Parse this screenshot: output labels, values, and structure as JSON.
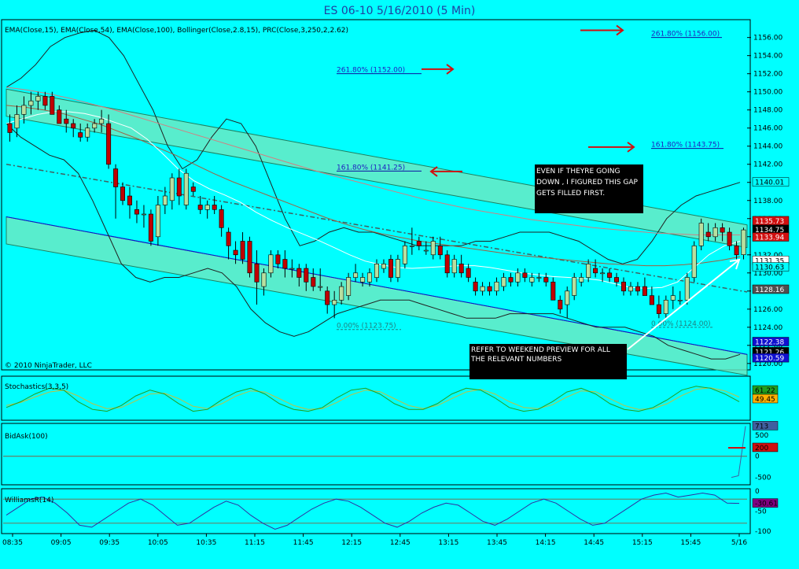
{
  "title": "ES 06-10  5/16/2010 (5 Min)",
  "colors": {
    "background": "#00FFFF",
    "up_candle": "#B8E0A0",
    "down_candle": "#C00000",
    "band": "#6EE8C0",
    "arrow": "#D01010",
    "axis_text": "#000000"
  },
  "chart_data": [
    {
      "type": "candlestick",
      "name": "price_panel",
      "indicator_label": "EMA(Close,15), EMA(Close,54), EMA(Close,100), Bollinger(Close,2.8,15), PRC(Close,3,250,2,2.62)",
      "copyright": "© 2010 NinjaTrader, LLC",
      "yticks": [
        1120,
        1122,
        1124,
        1126,
        1128,
        1130,
        1132,
        1134,
        1136,
        1138,
        1140,
        1142,
        1144,
        1146,
        1148,
        1150,
        1152,
        1154,
        1156
      ],
      "ylim": [
        1119.9,
        1157.1
      ],
      "xlabels": [
        "08:35",
        "09:05",
        "09:35",
        "10:05",
        "10:35",
        "11:15",
        "11:45",
        "12:15",
        "12:45",
        "13:15",
        "13:45",
        "14:15",
        "14:45",
        "15:15",
        "15:45",
        "5/16"
      ],
      "candles": [
        [
          1146.5,
          1147.5,
          1144.5,
          1145.5
        ],
        [
          1146.0,
          1148.5,
          1145.0,
          1147.5
        ],
        [
          1147.5,
          1149.5,
          1146.5,
          1148.5
        ],
        [
          1148.5,
          1150.0,
          1147.5,
          1149.0
        ],
        [
          1149.0,
          1150.0,
          1148.0,
          1149.5
        ],
        [
          1149.5,
          1150.0,
          1148.0,
          1148.5
        ],
        [
          1149.5,
          1150.0,
          1147.5,
          1147.5
        ],
        [
          1148.0,
          1148.5,
          1146.5,
          1146.5
        ],
        [
          1147.0,
          1148.0,
          1145.5,
          1146.5
        ],
        [
          1146.5,
          1147.0,
          1145.0,
          1146.0
        ],
        [
          1145.5,
          1146.5,
          1144.5,
          1145.0
        ],
        [
          1145.0,
          1146.5,
          1144.5,
          1146.0
        ],
        [
          1146.0,
          1147.0,
          1145.5,
          1146.5
        ],
        [
          1146.5,
          1148.0,
          1145.5,
          1147.0
        ],
        [
          1146.5,
          1147.5,
          1141.5,
          1142.0
        ],
        [
          1141.5,
          1142.0,
          1136.0,
          1139.5
        ],
        [
          1139.5,
          1140.0,
          1137.5,
          1138.0
        ],
        [
          1138.5,
          1139.5,
          1136.0,
          1137.5
        ],
        [
          1137.0,
          1138.0,
          1135.5,
          1136.5
        ],
        [
          1136.5,
          1137.5,
          1135.0,
          1136.5
        ],
        [
          1136.5,
          1137.0,
          1133.0,
          1133.5
        ],
        [
          1134.0,
          1138.5,
          1133.0,
          1137.5
        ],
        [
          1137.5,
          1139.5,
          1136.5,
          1138.5
        ],
        [
          1138.0,
          1141.0,
          1137.0,
          1140.5
        ],
        [
          1140.5,
          1141.5,
          1137.5,
          1138.5
        ],
        [
          1137.5,
          1141.5,
          1137.0,
          1141.0
        ],
        [
          1139.5,
          1140.0,
          1138.5,
          1139.0
        ],
        [
          1137.5,
          1138.5,
          1136.5,
          1137.0
        ],
        [
          1137.0,
          1138.0,
          1136.0,
          1137.5
        ],
        [
          1137.5,
          1138.5,
          1136.5,
          1137.0
        ],
        [
          1137.0,
          1137.5,
          1134.0,
          1135.0
        ],
        [
          1134.5,
          1135.0,
          1131.5,
          1133.0
        ],
        [
          1132.5,
          1133.5,
          1131.0,
          1132.0
        ],
        [
          1133.5,
          1134.5,
          1131.0,
          1131.5
        ],
        [
          1133.5,
          1134.0,
          1129.5,
          1130.0
        ],
        [
          1131.0,
          1132.5,
          1126.5,
          1129.0
        ],
        [
          1128.5,
          1130.5,
          1127.5,
          1130.0
        ],
        [
          1130.0,
          1132.5,
          1129.5,
          1132.0
        ],
        [
          1132.0,
          1132.5,
          1130.5,
          1131.0
        ],
        [
          1131.5,
          1132.5,
          1129.5,
          1130.5
        ],
        [
          1130.5,
          1131.5,
          1129.5,
          1130.5
        ],
        [
          1130.5,
          1131.0,
          1128.5,
          1129.5
        ],
        [
          1130.5,
          1131.0,
          1128.0,
          1129.0
        ],
        [
          1129.5,
          1130.5,
          1128.0,
          1128.5
        ],
        [
          1128.5,
          1130.5,
          1128.0,
          1128.5
        ],
        [
          1128.0,
          1128.5,
          1125.5,
          1126.5
        ],
        [
          1126.5,
          1128.0,
          1125.0,
          1127.0
        ],
        [
          1127.0,
          1129.0,
          1126.5,
          1128.5
        ],
        [
          1127.5,
          1130.0,
          1127.0,
          1129.5
        ],
        [
          1129.5,
          1131.0,
          1129.0,
          1130.0
        ],
        [
          1129.0,
          1130.0,
          1128.5,
          1129.5
        ],
        [
          1129.0,
          1130.5,
          1128.5,
          1130.0
        ],
        [
          1129.5,
          1131.5,
          1129.0,
          1131.0
        ],
        [
          1130.5,
          1131.5,
          1130.0,
          1131.0
        ],
        [
          1131.5,
          1132.0,
          1129.0,
          1129.5
        ],
        [
          1129.5,
          1132.0,
          1129.0,
          1131.5
        ],
        [
          1131.0,
          1133.5,
          1130.5,
          1133.0
        ],
        [
          1133.0,
          1135.0,
          1132.0,
          1133.0
        ],
        [
          1133.5,
          1134.0,
          1132.5,
          1133.0
        ],
        [
          1132.5,
          1133.5,
          1132.0,
          1132.5
        ],
        [
          1132.0,
          1134.0,
          1131.5,
          1133.5
        ],
        [
          1133.0,
          1134.0,
          1131.5,
          1132.0
        ],
        [
          1132.0,
          1132.5,
          1129.5,
          1130.0
        ],
        [
          1130.0,
          1132.0,
          1129.5,
          1131.5
        ],
        [
          1131.0,
          1132.0,
          1129.5,
          1130.0
        ],
        [
          1130.5,
          1131.0,
          1129.0,
          1129.5
        ],
        [
          1129.0,
          1129.5,
          1127.5,
          1128.0
        ],
        [
          1128.0,
          1129.0,
          1127.5,
          1128.5
        ],
        [
          1128.5,
          1129.0,
          1127.5,
          1128.0
        ],
        [
          1128.0,
          1129.5,
          1127.5,
          1129.0
        ],
        [
          1128.5,
          1130.0,
          1128.0,
          1129.5
        ],
        [
          1129.5,
          1130.0,
          1128.5,
          1129.0
        ],
        [
          1129.0,
          1130.5,
          1128.5,
          1130.0
        ],
        [
          1130.0,
          1130.5,
          1129.0,
          1129.5
        ],
        [
          1129.0,
          1130.0,
          1128.5,
          1129.5
        ],
        [
          1129.5,
          1130.0,
          1129.0,
          1129.5
        ],
        [
          1129.5,
          1130.0,
          1128.5,
          1129.0
        ],
        [
          1129.0,
          1129.5,
          1127.5,
          1127.0
        ],
        [
          1127.0,
          1127.5,
          1125.5,
          1126.0
        ],
        [
          1126.5,
          1128.5,
          1125.0,
          1128.0
        ],
        [
          1127.5,
          1130.0,
          1127.0,
          1129.5
        ],
        [
          1129.0,
          1130.0,
          1128.5,
          1129.5
        ],
        [
          1129.5,
          1131.5,
          1129.0,
          1131.0
        ],
        [
          1130.5,
          1131.5,
          1129.5,
          1130.0
        ],
        [
          1130.0,
          1130.5,
          1129.0,
          1130.0
        ],
        [
          1130.0,
          1130.5,
          1129.0,
          1129.5
        ],
        [
          1129.5,
          1130.0,
          1128.5,
          1129.0
        ],
        [
          1129.0,
          1129.5,
          1127.5,
          1128.0
        ],
        [
          1128.0,
          1129.0,
          1127.5,
          1128.5
        ],
        [
          1128.5,
          1129.0,
          1127.5,
          1128.0
        ],
        [
          1128.5,
          1129.5,
          1127.5,
          1127.5
        ],
        [
          1127.5,
          1128.5,
          1126.5,
          1126.5
        ],
        [
          1126.5,
          1127.5,
          1125.0,
          1125.5
        ],
        [
          1125.5,
          1127.5,
          1125.0,
          1127.0
        ],
        [
          1127.0,
          1128.5,
          1126.0,
          1127.5
        ],
        [
          1127.0,
          1128.0,
          1126.5,
          1127.0
        ],
        [
          1127.0,
          1130.0,
          1126.5,
          1129.5
        ],
        [
          1129.5,
          1133.5,
          1129.0,
          1133.0
        ],
        [
          1133.0,
          1136.0,
          1132.5,
          1135.5
        ],
        [
          1134.5,
          1135.5,
          1133.5,
          1134.0
        ],
        [
          1134.0,
          1135.5,
          1133.5,
          1135.0
        ],
        [
          1135.0,
          1135.5,
          1133.5,
          1134.5
        ],
        [
          1134.5,
          1135.0,
          1132.5,
          1133.0
        ],
        [
          1133.0,
          1133.5,
          1131.5,
          1132.0
        ],
        [
          1132.0,
          1135.0,
          1131.5,
          1134.75
        ]
      ],
      "ema_15": [
        1146.5,
        1147.0,
        1147.5,
        1147.8,
        1147.8,
        1147.6,
        1147.2,
        1146.6,
        1146.0,
        1144.8,
        1143.2,
        1141.5,
        1140.2,
        1139.3,
        1138.6,
        1137.8,
        1136.7,
        1135.8,
        1135.0,
        1134.3,
        1133.6,
        1132.8,
        1132.0,
        1131.3,
        1130.9,
        1130.6,
        1130.5,
        1130.6,
        1130.7,
        1130.8,
        1130.8,
        1130.6,
        1130.3,
        1130.0,
        1129.8,
        1129.6,
        1129.5,
        1129.4,
        1129.2,
        1128.8,
        1128.4,
        1128.3,
        1128.4,
        1129.0,
        1130.5,
        1132.0,
        1133.0,
        1133.5
      ],
      "ema_54": [
        1148.5,
        1148.3,
        1148.0,
        1147.6,
        1147.0,
        1146.4,
        1145.6,
        1144.8,
        1143.9,
        1143.0,
        1142.0,
        1141.0,
        1140.1,
        1139.3,
        1138.5,
        1137.7,
        1136.9,
        1136.1,
        1135.4,
        1134.8,
        1134.3,
        1133.9,
        1133.5,
        1133.2,
        1132.9,
        1132.6,
        1132.3,
        1132.0,
        1131.8,
        1131.6,
        1131.4,
        1131.2,
        1131.0,
        1130.9,
        1130.8,
        1130.8,
        1130.9,
        1131.1,
        1131.4,
        1131.8
      ],
      "ema_100": [
        1150.5,
        1150.2,
        1149.8,
        1149.3,
        1148.7,
        1148.1,
        1147.4,
        1146.7,
        1146.0,
        1145.3,
        1144.6,
        1143.9,
        1143.2,
        1142.5,
        1141.8,
        1141.1,
        1140.5,
        1139.9,
        1139.3,
        1138.7,
        1138.1,
        1137.6,
        1137.1,
        1136.7,
        1136.3,
        1135.9,
        1135.6,
        1135.3,
        1135.0,
        1134.8,
        1134.6,
        1134.4,
        1134.3,
        1134.2,
        1134.2,
        1134.2
      ],
      "bb_upper": [
        1150.5,
        1151.5,
        1153.0,
        1155.0,
        1156.0,
        1156.5,
        1156.8,
        1156.0,
        1154.0,
        1151.0,
        1148.0,
        1144.0,
        1141.5,
        1142.5,
        1145.0,
        1147.0,
        1146.5,
        1144.0,
        1140.0,
        1136.0,
        1133.0,
        1133.5,
        1134.5,
        1135.0,
        1134.5,
        1134.5,
        1134.0,
        1133.5,
        1133.0,
        1133.0,
        1133.0,
        1133.0,
        1133.5,
        1133.5,
        1134.0,
        1134.5,
        1134.5,
        1134.5,
        1134.0,
        1133.5,
        1132.5,
        1131.5,
        1131.0,
        1131.5,
        1133.5,
        1136.0,
        1137.5,
        1138.5,
        1139.0,
        1139.5,
        1140.0
      ],
      "bb_lower": [
        1146.5,
        1145.0,
        1144.0,
        1143.0,
        1142.5,
        1141.0,
        1138.0,
        1134.5,
        1131.0,
        1129.5,
        1129.0,
        1129.5,
        1129.5,
        1130.0,
        1130.5,
        1130.0,
        1128.5,
        1126.0,
        1124.5,
        1123.5,
        1123.0,
        1123.5,
        1124.5,
        1125.5,
        1126.0,
        1126.5,
        1127.0,
        1127.0,
        1127.0,
        1126.5,
        1126.0,
        1125.5,
        1125.0,
        1125.0,
        1125.0,
        1125.5,
        1125.5,
        1125.5,
        1125.5,
        1125.0,
        1124.5,
        1124.0,
        1124.0,
        1124.0,
        1123.5,
        1123.0,
        1122.0,
        1121.5,
        1121.0,
        1120.5,
        1120.5,
        1121.0
      ],
      "fib_levels": [
        {
          "label": "261.80% (1156.00)",
          "price": 1156.0
        },
        {
          "label": "261.80% (1152.00)",
          "price": 1152.0
        },
        {
          "label": "161.80% (1143.75)",
          "price": 1143.75
        },
        {
          "label": "161.80% (1141.25)",
          "price": 1141.25
        },
        {
          "label": "0.00% (1123.75)",
          "price": 1123.75
        },
        {
          "label": "0.00% (1124.00)",
          "price": 1124.0
        }
      ],
      "price_badges": [
        {
          "value": "1140.01",
          "color": "#00FFFF",
          "text_color": "#000000"
        },
        {
          "value": "1135.73",
          "color": "#D01010",
          "text_color": "#FFFFFF"
        },
        {
          "value": "1134.75",
          "color": "#000000",
          "text_color": "#FFFFFF"
        },
        {
          "value": "1133.94",
          "color": "#D01010",
          "text_color": "#FFFFFF"
        },
        {
          "value": "1131.35",
          "color": "#FFFFFF",
          "text_color": "#000000"
        },
        {
          "value": "1130.63",
          "color": "#00FFFF",
          "text_color": "#000000"
        },
        {
          "value": "1128.16",
          "color": "#505050",
          "text_color": "#FFFFFF"
        },
        {
          "value": "1122.38",
          "color": "#1010D0",
          "text_color": "#FFFFFF"
        },
        {
          "value": "1121.26",
          "color": "#000000",
          "text_color": "#FFFFFF"
        },
        {
          "value": "1120.59",
          "color": "#1010D0",
          "text_color": "#FFFFFF"
        }
      ],
      "annotations": [
        {
          "text": "EVEN IF THEYRE GOING DOWN , I FIGURED THIS GAP GETS FILLED FIRST."
        },
        {
          "text": "REFER TO WEEKEND PREVIEW FOR ALL THE RELEVANT NUMBERS"
        }
      ]
    },
    {
      "type": "line",
      "name": "stochastics_panel",
      "label": "Stochastics(3,3,5)",
      "k_values": [
        25,
        40,
        60,
        75,
        70,
        40,
        20,
        15,
        30,
        55,
        70,
        60,
        35,
        15,
        20,
        45,
        65,
        75,
        60,
        35,
        20,
        15,
        25,
        50,
        70,
        75,
        60,
        35,
        20,
        20,
        35,
        60,
        75,
        70,
        50,
        25,
        15,
        20,
        40,
        65,
        75,
        60,
        35,
        20,
        15,
        25,
        45,
        70,
        80,
        75,
        60,
        40
      ],
      "d_values": [
        30,
        38,
        52,
        65,
        70,
        55,
        35,
        22,
        25,
        42,
        60,
        62,
        48,
        28,
        22,
        35,
        55,
        68,
        65,
        48,
        30,
        20,
        22,
        38,
        58,
        70,
        66,
        48,
        30,
        22,
        30,
        48,
        65,
        72,
        60,
        40,
        25,
        22,
        32,
        52,
        68,
        66,
        48,
        30,
        20,
        22,
        35,
        56,
        72,
        76,
        68,
        52
      ],
      "badges": [
        {
          "value": "61.22",
          "color": "#20A020"
        },
        {
          "value": "49.45",
          "color": "#FFB000"
        }
      ]
    },
    {
      "type": "line",
      "name": "bidask_panel",
      "label": "BidAsk(100)",
      "yticks": [
        -500,
        0,
        500
      ],
      "ylim": [
        -600,
        720
      ],
      "values": [
        -500,
        -460,
        713
      ],
      "badges": [
        {
          "value": "713",
          "color": "#4060A0"
        },
        {
          "value": "200",
          "color": "#D01010"
        }
      ]
    },
    {
      "type": "line",
      "name": "williamsr_panel",
      "label": "WilliamsR(14)",
      "yticks": [
        0,
        -50,
        -100
      ],
      "ylim": [
        -100,
        0
      ],
      "values": [
        -60,
        -40,
        -20,
        -15,
        -30,
        -55,
        -85,
        -90,
        -70,
        -50,
        -30,
        -20,
        -35,
        -60,
        -85,
        -80,
        -60,
        -40,
        -25,
        -35,
        -60,
        -80,
        -95,
        -85,
        -65,
        -45,
        -30,
        -20,
        -25,
        -40,
        -60,
        -80,
        -90,
        -75,
        -55,
        -40,
        -30,
        -35,
        -55,
        -75,
        -85,
        -70,
        -50,
        -30,
        -20,
        -30,
        -50,
        -70,
        -85,
        -80,
        -60,
        -40,
        -20,
        -10,
        -5,
        -15,
        -10,
        -5,
        -10,
        -30,
        -30.61
      ],
      "badges": [
        {
          "value": "-30.61",
          "color": "#800080"
        }
      ]
    }
  ]
}
